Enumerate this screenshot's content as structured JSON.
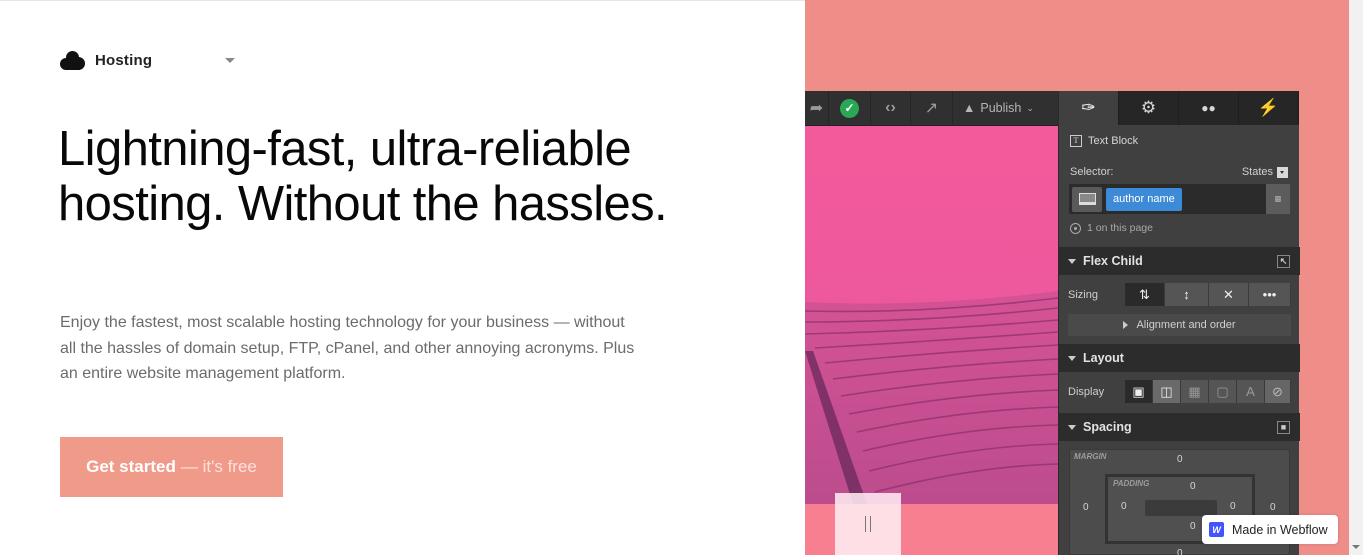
{
  "product_menu": {
    "label": "Hosting",
    "icon": "cloud-icon"
  },
  "hero": {
    "headline": "Lightning-fast, ultra-reliable hosting. Without the hassles.",
    "subcopy": "Enjoy the fastest, most scalable hosting technology for your business — without all the hassles of domain setup, FTP, cPanel, and other annoying acronyms. Plus an entire website management platform.",
    "cta_strong": "Get started",
    "cta_light": "— it's free"
  },
  "designer": {
    "toolbar": {
      "icons": [
        "redo-icon",
        "check-icon",
        "code-icon",
        "export-icon",
        "rocket-icon"
      ],
      "publish_label": "Publish"
    },
    "panel_tabs": [
      "style-brush-icon",
      "settings-gear-icon",
      "color-drops-icon",
      "interactions-bolt-icon"
    ],
    "element_type": "Text Block",
    "selector_label": "Selector:",
    "states_label": "States",
    "selector_chip": "author name",
    "on_page_count": "1 on this page",
    "sections": {
      "flex_child": "Flex Child",
      "sizing_label": "Sizing",
      "alignment_label": "Alignment and order",
      "layout": "Layout",
      "display_label": "Display",
      "spacing": "Spacing"
    },
    "box_model": {
      "margin_label": "MARGIN",
      "padding_label": "PADDING",
      "margin": {
        "top": "0",
        "right": "0",
        "bottom": "0",
        "left": "0"
      },
      "padding": {
        "top": "0",
        "right": "0",
        "bottom": "0",
        "left": "0"
      }
    }
  },
  "badge": {
    "label": "Made in Webflow",
    "logo": "W"
  },
  "colors": {
    "cta": "#f09a8a",
    "salmon_bg": "#ef8d88",
    "selector_chip": "#3d8ad6",
    "publish_check": "#2aa856",
    "webflow_blue": "#4353ff"
  }
}
